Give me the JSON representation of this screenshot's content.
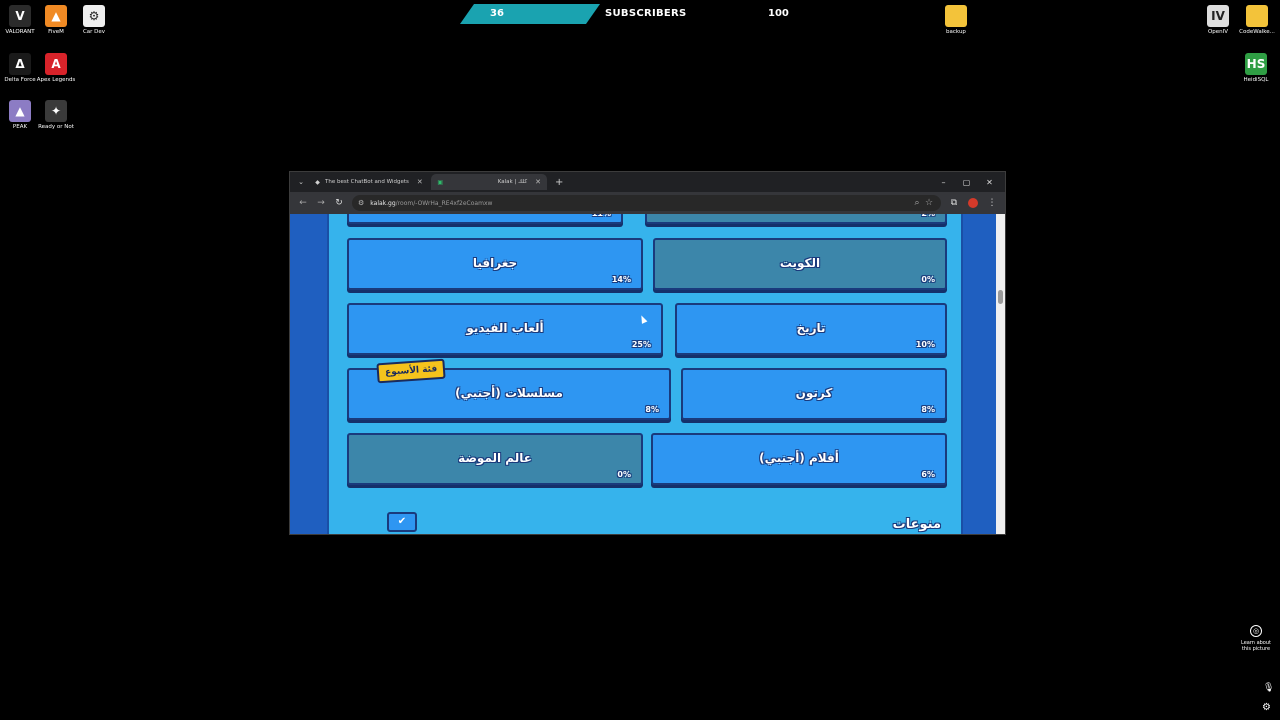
{
  "desktop": {
    "icons": [
      {
        "label": "VALORANT",
        "glyph": "V",
        "color": "#2b2b2b",
        "icon": "valorant-icon"
      },
      {
        "label": "FiveM",
        "glyph": "▲",
        "color": "#f08a24",
        "icon": "fivem-icon"
      },
      {
        "label": "Car Dev",
        "glyph": "⚙",
        "color": "#eeeeee",
        "icon": "car-dev-icon"
      },
      {
        "label": "Delta Force",
        "glyph": "Δ",
        "color": "#1a1a1a",
        "icon": "delta-force-icon"
      },
      {
        "label": "Apex Legends",
        "glyph": "A",
        "color": "#d8232a",
        "icon": "apex-legends-icon"
      },
      {
        "label": "PEAK",
        "glyph": "▲",
        "color": "#8c7cc4",
        "icon": "peak-icon"
      },
      {
        "label": "Ready or Not",
        "glyph": "✦",
        "color": "#3a3a3a",
        "icon": "ready-or-not-icon"
      },
      {
        "label": "backup",
        "glyph": "",
        "color": "#f3c33a",
        "icon": "folder-icon"
      },
      {
        "label": "OpenIV",
        "glyph": "IV",
        "color": "#dddddd",
        "icon": "openiv-icon"
      },
      {
        "label": "CodeWalke...",
        "glyph": "",
        "color": "#f3c33a",
        "icon": "folder-icon"
      },
      {
        "label": "HeidiSQL",
        "glyph": "HS",
        "color": "#2f9e44",
        "icon": "heidisql-icon"
      }
    ]
  },
  "stream_overlay": {
    "current": "36",
    "label": "SUBSCRIBERS",
    "goal": "100",
    "progress": 0.36,
    "color": "#1aa3b0"
  },
  "browser": {
    "tabs": [
      {
        "title": "The best ChatBot and Widgets",
        "active": false
      },
      {
        "title": "Kalak | كلك",
        "active": true
      }
    ],
    "url_host": "kalak.gg",
    "url_path": "/room/-OWrHa_RE4xf2eCoamxw"
  },
  "game": {
    "categories": [
      {
        "name": "جغرافيا",
        "pct": "14%",
        "selected": true
      },
      {
        "name": "الكويت",
        "pct": "0%",
        "selected": false
      },
      {
        "name": "ألعاب الفيديو",
        "pct": "25%",
        "selected": true
      },
      {
        "name": "تاريخ",
        "pct": "10%",
        "selected": true
      },
      {
        "name": "مسلسلات (أجنبي)",
        "pct": "8%",
        "selected": true
      },
      {
        "name": "كرتون",
        "pct": "8%",
        "selected": true
      },
      {
        "name": "عالم الموضة",
        "pct": "0%",
        "selected": false
      },
      {
        "name": "أفلام (أجنبي)",
        "pct": "6%",
        "selected": true
      }
    ],
    "top_partial": [
      {
        "pct": "11%"
      },
      {
        "pct": "2%"
      }
    ],
    "weekly_badge": "فئة الأسبوع",
    "section_title": "منوعات",
    "colors": {
      "selected": "#2e96f2",
      "unselected": "#3c86aa",
      "panel": "#36b3ec"
    }
  },
  "learn": {
    "line1": "Learn about",
    "line2": "this picture"
  }
}
